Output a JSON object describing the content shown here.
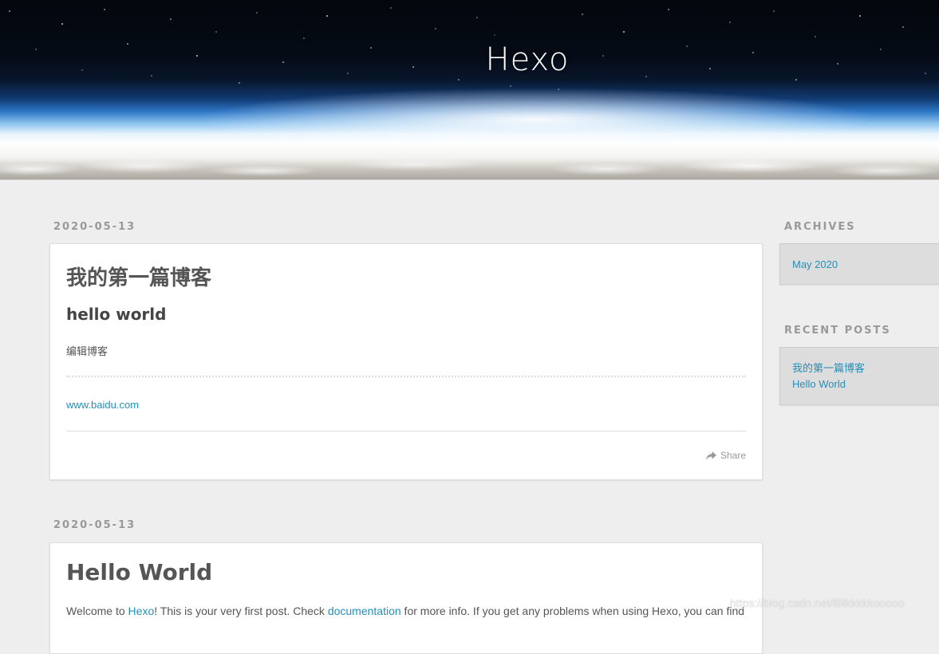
{
  "header": {
    "title": "Hexo"
  },
  "articles": [
    {
      "date": "2020-05-13",
      "title": "我的第一篇博客",
      "heading": "hello world",
      "paragraph": "编辑博客",
      "link": "www.baidu.com",
      "share_label": "Share"
    },
    {
      "date": "2020-05-13",
      "title": "Hello World",
      "intro": {
        "before_hexo": "Welcome to ",
        "hexo_link": "Hexo",
        "after_hexo": "! This is your very first post. Check ",
        "docs_link": "documentation",
        "after_docs": " for more info. If you get any problems when using Hexo, you can find"
      }
    }
  ],
  "sidebar": {
    "archives": {
      "title": "ARCHIVES",
      "items": [
        "May 2020"
      ]
    },
    "recent_posts": {
      "title": "RECENT POSTS",
      "items": [
        "我的第一篇博客",
        "Hello World"
      ]
    }
  },
  "watermark": "https://blog.csdn.net/lllllkkkkkooooo",
  "colors": {
    "link": "#258fb8",
    "background": "#eeeeee",
    "text": "#555555",
    "muted": "#999999"
  }
}
